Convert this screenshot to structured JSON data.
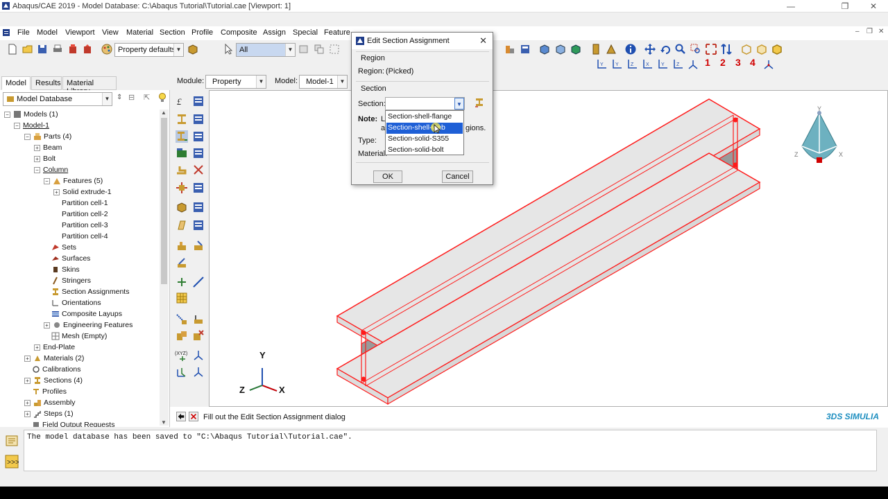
{
  "window": {
    "title": "Abaqus/CAE 2019 - Model Database: C:\\Abaqus Tutorial\\Tutorial.cae [Viewport: 1]"
  },
  "menu": {
    "items": [
      "File",
      "Model",
      "Viewport",
      "View",
      "Material",
      "Section",
      "Profile",
      "Composite",
      "Assign",
      "Special",
      "Feature"
    ]
  },
  "toolbar": {
    "render_style": "Property defaults",
    "selection_filter": "All"
  },
  "context": {
    "module_label": "Module:",
    "module_value": "Property",
    "model_label": "Model:",
    "model_value": "Model-1"
  },
  "tabs": [
    "Model",
    "Results",
    "Material Library"
  ],
  "tree": {
    "database_combo": "Model Database",
    "rows": [
      "Models (1)",
      "Model-1",
      "Parts (4)",
      "Beam",
      "Bolt",
      "Column",
      "Features (5)",
      "Solid extrude-1",
      "Partition cell-1",
      "Partition cell-2",
      "Partition cell-3",
      "Partition cell-4",
      "Sets",
      "Surfaces",
      "Skins",
      "Stringers",
      "Section Assignments",
      "Orientations",
      "Composite Layups",
      "Engineering Features",
      "Mesh (Empty)",
      "End-Plate",
      "Materials (2)",
      "Calibrations",
      "Sections (4)",
      "Profiles",
      "Assembly",
      "Steps (1)",
      "Field Output Requests"
    ]
  },
  "dialog": {
    "title": "Edit Section Assignment",
    "region_group": "Region",
    "region_label": "Region:",
    "region_value": "(Picked)",
    "section_group": "Section",
    "section_label": "Section:",
    "section_value": "",
    "note_label": "Note:",
    "note_text_a": "L",
    "note_text_b": "a",
    "note_text_c": "gions.",
    "type_label": "Type:",
    "material_label": "Material:",
    "ok": "OK",
    "cancel": "Cancel",
    "options": [
      "Section-shell-flange",
      "Section-shell-web",
      "Section-solid-S355",
      "Section-solid-bolt"
    ],
    "selected_index": 1
  },
  "prompt": {
    "text": "Fill out the Edit Section Assignment dialog"
  },
  "messages": {
    "line1": "The model database has been saved to \"C:\\Abaqus Tutorial\\Tutorial.cae\"."
  },
  "triad": {
    "y": "Y",
    "x": "X",
    "z": "Z"
  },
  "view_triad": {
    "y": "Y",
    "x": "X",
    "z": "Z"
  },
  "brand": "3DS SIMULIA",
  "view_numbers": [
    "1",
    "2",
    "3",
    "4"
  ],
  "colors": {
    "accent_red": "#e00000",
    "selection_blue": "#1e5fd6",
    "model_red": "#ff1a1a"
  }
}
